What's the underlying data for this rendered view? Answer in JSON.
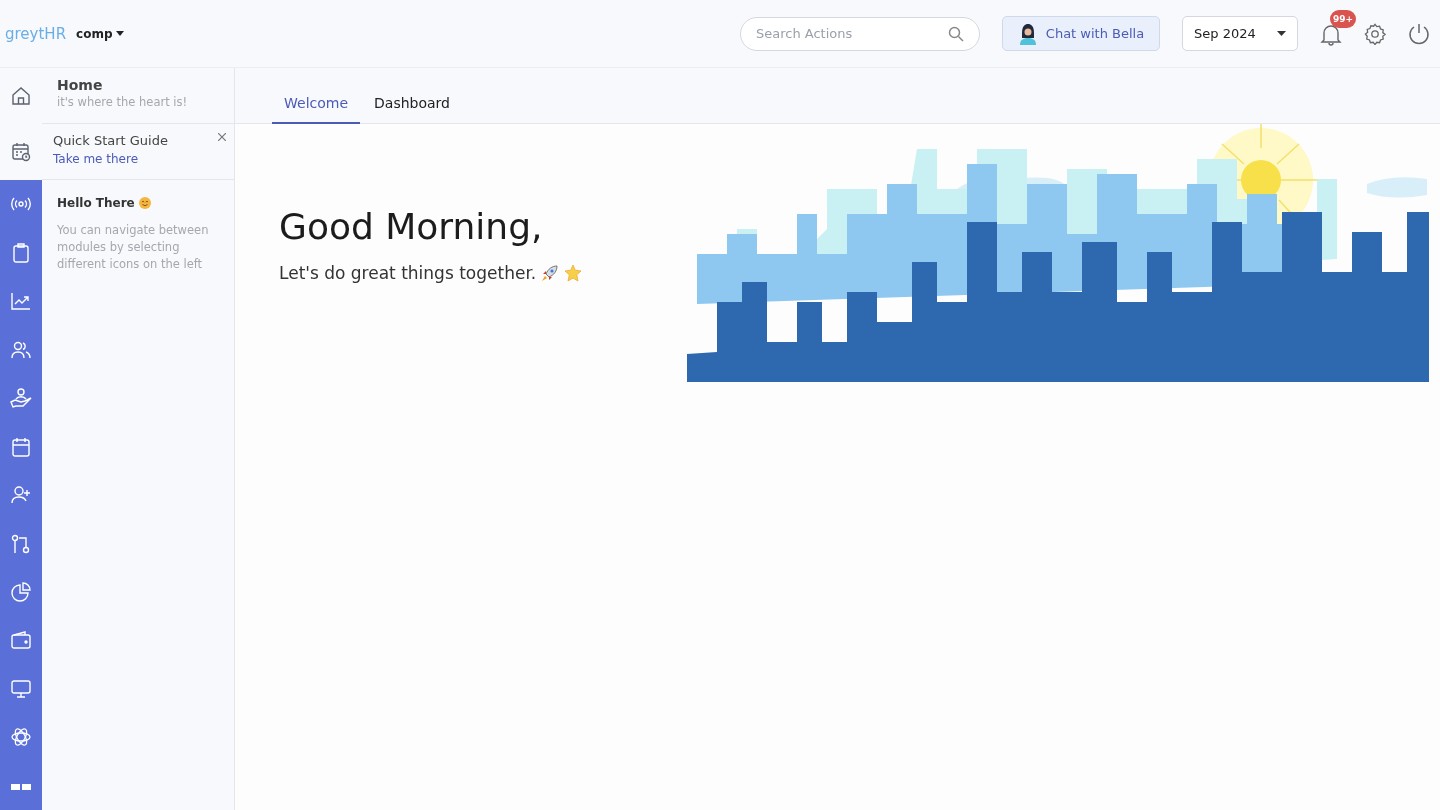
{
  "header": {
    "logo": "greytHR",
    "company": "comp",
    "search": {
      "placeholder": "Search Actions"
    },
    "chat_button": "Chat with Bella",
    "period": "Sep 2024",
    "notification_count": "99+"
  },
  "rail": {
    "items": [
      {
        "kind": "home"
      },
      {
        "kind": "guide"
      },
      {
        "kind": "broadcast"
      },
      {
        "kind": "clipboard"
      },
      {
        "kind": "chart"
      },
      {
        "kind": "people"
      },
      {
        "kind": "care"
      },
      {
        "kind": "calendar"
      },
      {
        "kind": "person-add"
      },
      {
        "kind": "flow"
      },
      {
        "kind": "pie"
      },
      {
        "kind": "wallet"
      },
      {
        "kind": "monitor"
      },
      {
        "kind": "atom"
      },
      {
        "kind": "more"
      }
    ]
  },
  "panel": {
    "home": {
      "title": "Home",
      "subtitle": "it's where the heart is!"
    },
    "guide": {
      "title": "Quick Start Guide",
      "link": "Take me there"
    },
    "hint": {
      "title": "Hello There",
      "text": "You can navigate between modules by selecting different icons on the left"
    }
  },
  "tabs": [
    {
      "label": "Welcome",
      "selected": true
    },
    {
      "label": "Dashboard",
      "selected": false
    }
  ],
  "welcome": {
    "greeting": "Good Morning,",
    "tagline": "Let's do great things together."
  }
}
